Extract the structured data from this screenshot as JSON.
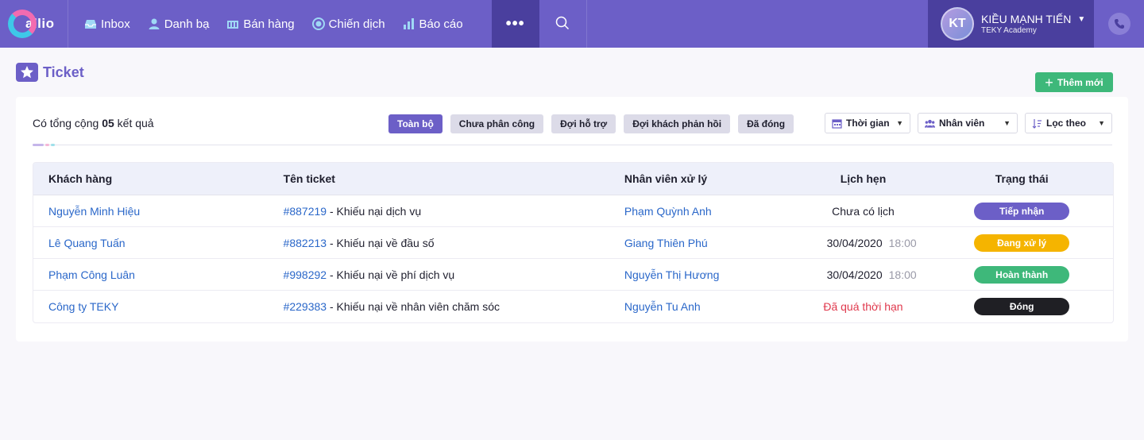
{
  "brand": {
    "name": "allio"
  },
  "nav": {
    "items": [
      {
        "label": "Inbox",
        "icon": "inbox-icon"
      },
      {
        "label": "Danh bạ",
        "icon": "contacts-icon"
      },
      {
        "label": "Bán hàng",
        "icon": "sales-icon"
      },
      {
        "label": "Chiến dịch",
        "icon": "campaign-icon"
      },
      {
        "label": "Báo cáo",
        "icon": "report-icon"
      }
    ],
    "more_label": "•••"
  },
  "user": {
    "initials": "KT",
    "name": "KIỀU MẠNH TIẾN",
    "org": "TEKY Academy"
  },
  "page": {
    "title": "Ticket",
    "add_label": "Thêm mới"
  },
  "summary": {
    "prefix": "Có tổng cộng",
    "count": "05",
    "suffix": "kết quả"
  },
  "tabs": [
    {
      "label": "Toàn bộ",
      "active": true
    },
    {
      "label": "Chưa phân công",
      "active": false
    },
    {
      "label": "Đợi hỗ trợ",
      "active": false
    },
    {
      "label": "Đợi khách phản hồi",
      "active": false
    },
    {
      "label": "Đã đóng",
      "active": false
    }
  ],
  "filters": [
    {
      "label": "Thời gian",
      "icon": "calendar-icon"
    },
    {
      "label": "Nhân viên",
      "icon": "team-icon"
    },
    {
      "label": "Lọc theo",
      "icon": "sort-icon"
    }
  ],
  "table": {
    "headers": [
      "Khách hàng",
      "Tên ticket",
      "Nhân viên xử lý",
      "Lịch hẹn",
      "Trạng thái"
    ],
    "rows": [
      {
        "customer": "Nguyễn Minh Hiệu",
        "ticket_id": "#887219",
        "ticket_name": " - Khiếu nại dịch vụ",
        "staff": "Phạm Quỳnh Anh",
        "date": "Chưa có lịch",
        "time": "",
        "date_overdue": false,
        "status": "Tiếp nhận",
        "status_color": "#6c5fc7"
      },
      {
        "customer": "Lê Quang Tuấn",
        "ticket_id": "#882213",
        "ticket_name": " - Khiếu nại về đầu số",
        "staff": "Giang Thiên Phú",
        "date": "30/04/2020",
        "time": "18:00",
        "date_overdue": false,
        "status": "Đang xử lý",
        "status_color": "#f5b400"
      },
      {
        "customer": "Phạm Công Luân",
        "ticket_id": "#998292",
        "ticket_name": " - Khiếu nại về phí dịch vụ",
        "staff": "Nguyễn Thị Hương",
        "date": "30/04/2020",
        "time": "18:00",
        "date_overdue": false,
        "status": "Hoàn thành",
        "status_color": "#3eb87a"
      },
      {
        "customer": "Công ty TEKY",
        "ticket_id": "#229383",
        "ticket_name": " - Khiếu nại về nhân viên chăm sóc",
        "staff": "Nguyễn Tu Anh",
        "date": "Đã quá thời hạn",
        "time": "",
        "date_overdue": true,
        "status": "Đóng",
        "status_color": "#1f1f24"
      }
    ]
  },
  "colors": {
    "primary": "#6c5fc7",
    "primary_dark": "#4a3f9e",
    "success": "#3eb87a",
    "link": "#2a67c9",
    "danger": "#e0394d"
  }
}
